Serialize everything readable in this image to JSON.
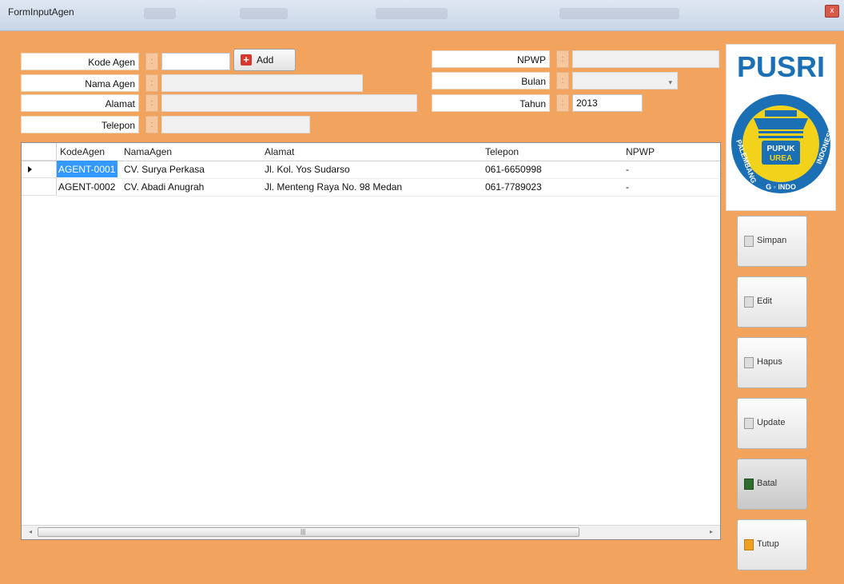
{
  "window": {
    "title": "FormInputAgen",
    "close_glyph": "x"
  },
  "form": {
    "kode_agen": {
      "label": "Kode Agen",
      "value": ""
    },
    "add_button": {
      "label": "Add"
    },
    "nama_agen": {
      "label": "Nama Agen",
      "value": ""
    },
    "alamat": {
      "label": "Alamat",
      "value": ""
    },
    "telepon": {
      "label": "Telepon",
      "value": ""
    },
    "npwp": {
      "label": "NPWP",
      "value": ""
    },
    "bulan": {
      "label": "Bulan",
      "value": ""
    },
    "tahun": {
      "label": "Tahun",
      "value": "2013"
    },
    "colon": ":"
  },
  "grid": {
    "columns": [
      "KodeAgen",
      "NamaAgen",
      "Alamat",
      "Telepon",
      "NPWP"
    ],
    "rows": [
      {
        "kode": "AGENT-0001",
        "nama": "CV. Surya Perkasa",
        "alamat": "Jl. Kol. Yos Sudarso",
        "telepon": "061-6650998",
        "npwp": "-"
      },
      {
        "kode": "AGENT-0002",
        "nama": "CV. Abadi Anugrah",
        "alamat": "Jl. Menteng Raya No. 98 Medan",
        "telepon": "061-7789023",
        "npwp": "-"
      }
    ],
    "scroll_left": "◂",
    "scroll_right": "▸",
    "scroll_grip": "|||"
  },
  "logo": {
    "brand": "PUSRI",
    "badge_line1": "PUPUK",
    "badge_line2": "UREA",
    "ring_left": "PALEMBANG",
    "ring_right": "INDONESIA",
    "ring_bottom": "G ◦ INDO"
  },
  "actions": {
    "simpan": "Simpan",
    "edit": "Edit",
    "hapus": "Hapus",
    "update": "Update",
    "batal": "Batal",
    "tutup": "Tutup"
  },
  "colors": {
    "form_background": "#f2a45e",
    "selection": "#3399ff",
    "logo_blue": "#1a6fb5",
    "logo_yellow": "#f3d21c"
  }
}
